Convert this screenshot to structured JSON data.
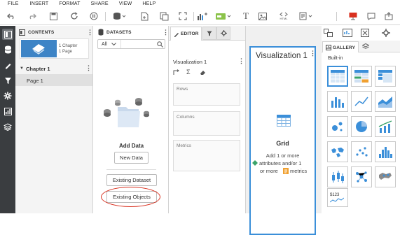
{
  "menu": [
    "FILE",
    "INSERT",
    "FORMAT",
    "SHARE",
    "VIEW",
    "HELP"
  ],
  "toolbar": {
    "html_label": "HTML"
  },
  "contents": {
    "title": "CONTENTS",
    "chapter_thumb_line1": "1 Chapter",
    "chapter_thumb_line2": "1 Page",
    "chapter_name": "Chapter 1",
    "page_name": "Page 1"
  },
  "datasets": {
    "title": "DATASETS",
    "filter_value": "All",
    "add_data_label": "Add Data",
    "new_data_label": "New Data",
    "existing_dataset_label": "Existing Dataset",
    "existing_objects_label": "Existing Objects"
  },
  "editor": {
    "title": "EDITOR",
    "viz_name": "Visualization 1",
    "rows_label": "Rows",
    "columns_label": "Columns",
    "metrics_label": "Metrics"
  },
  "canvas": {
    "viz_title": "Visualization 1",
    "grid_label": "Grid",
    "hint_line1": "Add 1 or more",
    "hint_line2": "attributes and/or 1",
    "hint_line3a": "or more",
    "hint_line3b": "metrics"
  },
  "gallery": {
    "title": "GALLERY",
    "builtin_label": "Built-in",
    "kpi_text": "$123"
  },
  "colors": {
    "accent": "#3b8fd9",
    "rail": "#3a3d40",
    "highlight_circle": "#d9301f",
    "thumb_blue": "#3d84c6"
  }
}
